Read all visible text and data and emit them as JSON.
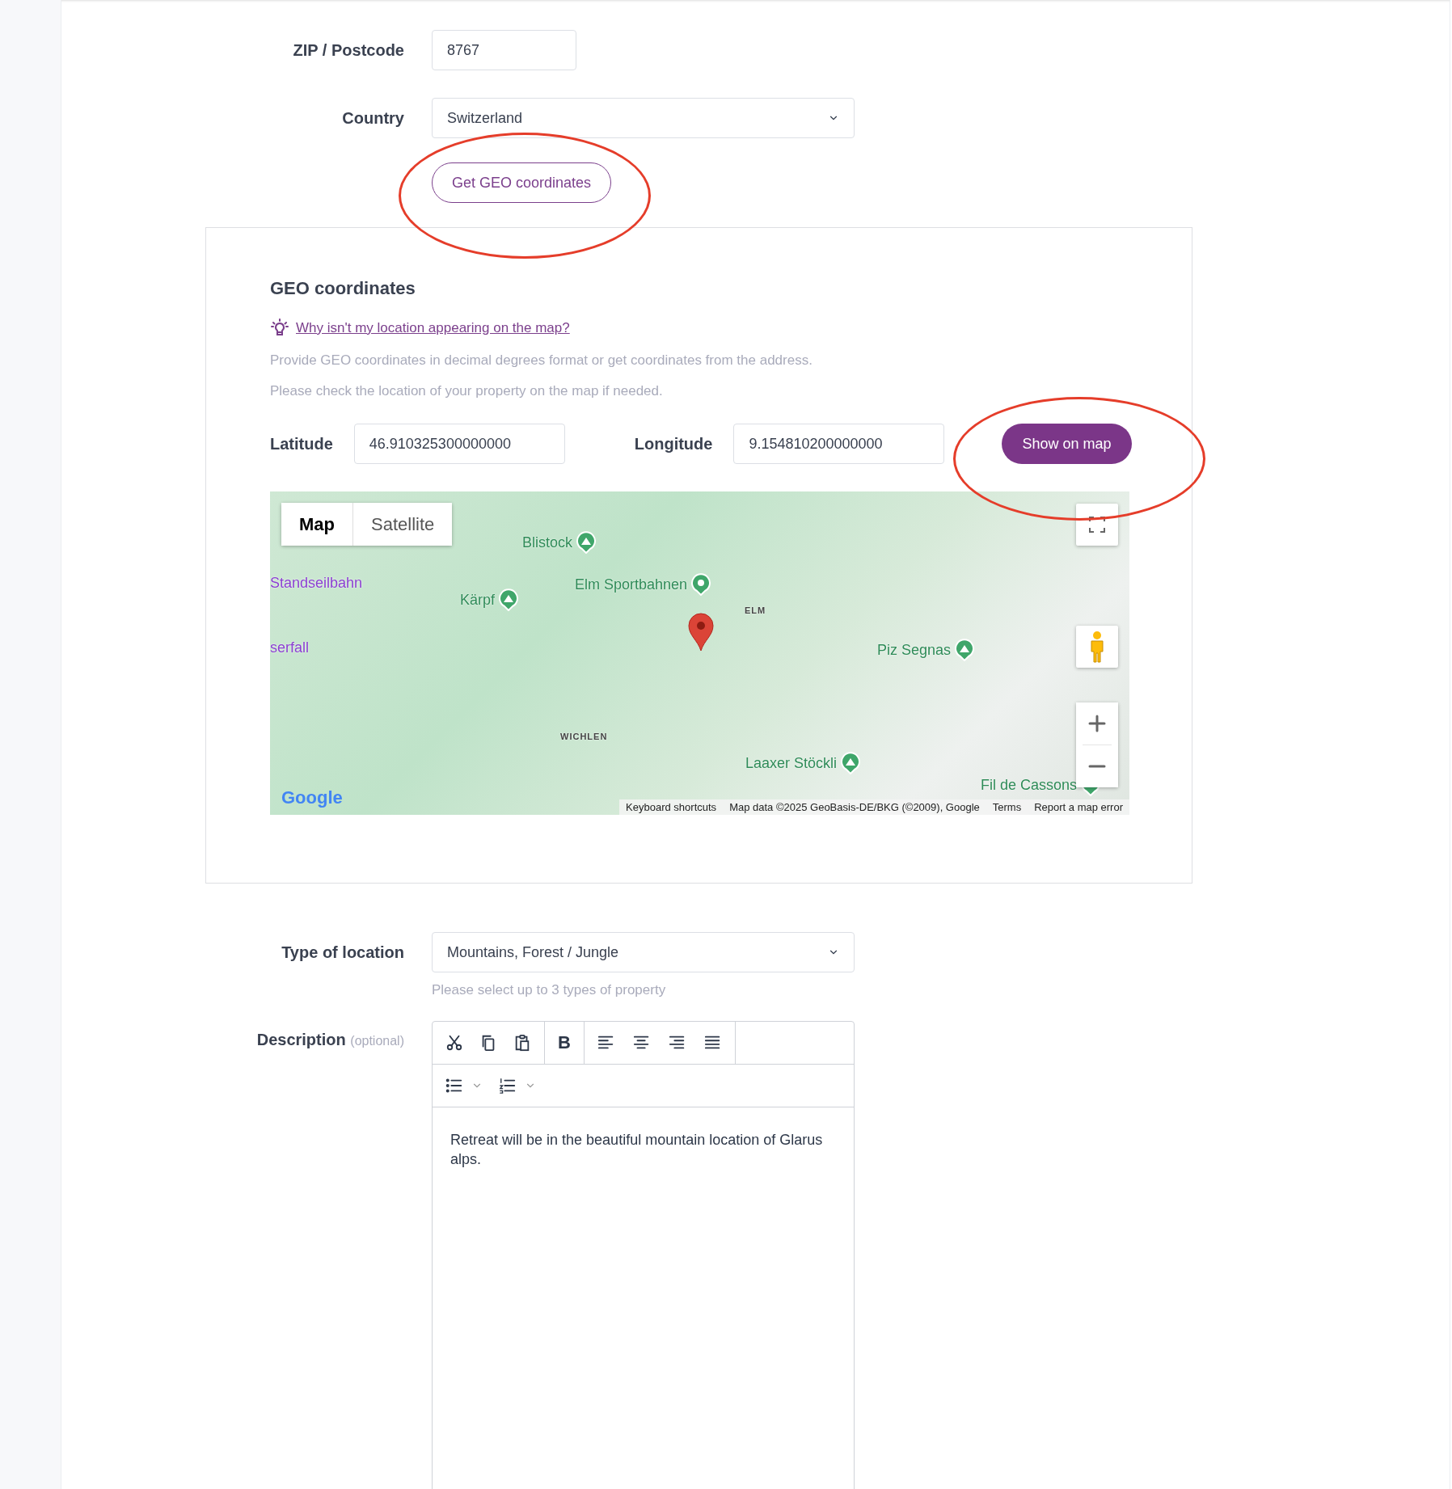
{
  "address": {
    "fields": [
      {
        "label": "ZIP / Postcode",
        "kind": "text",
        "value": "8767"
      },
      {
        "label": "Country",
        "kind": "select",
        "value": "Switzerland"
      }
    ],
    "geo_button": "Get GEO coordinates"
  },
  "geo_panel": {
    "title": "GEO coordinates",
    "help_link": "Why isn't my location appearing on the map?",
    "hints": [
      "Provide GEO coordinates in decimal degrees format or get coordinates from the address.",
      "Please check the location of your property on the map if needed."
    ],
    "latitude": {
      "label": "Latitude",
      "value": "46.910325300000000"
    },
    "longitude": {
      "label": "Longitude",
      "value": "9.154810200000000"
    },
    "show_button": "Show on map",
    "map": {
      "tabs": [
        {
          "label": "Map",
          "selected": true
        },
        {
          "label": "Satellite",
          "selected": false
        }
      ],
      "labels": [
        {
          "text": "Blistock",
          "kind": "peak"
        },
        {
          "text": "Elm Sportbahnen",
          "kind": "poi"
        },
        {
          "text": "Kärpf",
          "kind": "peak"
        },
        {
          "text": "ELM",
          "kind": "place"
        },
        {
          "text": "Standseilbahn",
          "kind": "transit"
        },
        {
          "text": "serfall",
          "kind": "transit"
        },
        {
          "text": "Piz Segnas",
          "kind": "peak"
        },
        {
          "text": "WICHLEN",
          "kind": "place"
        },
        {
          "text": "Laaxer Stöckli",
          "kind": "peak"
        },
        {
          "text": "Fil de Cassons",
          "kind": "peak"
        }
      ],
      "logo": "Google",
      "attribution": [
        "Keyboard shortcuts",
        "Map data ©2025 GeoBasis-DE/BKG (©2009), Google",
        "Terms",
        "Report a map error"
      ]
    }
  },
  "type_of_location": {
    "label": "Type of location",
    "value": "Mountains, Forest / Jungle",
    "hint": "Please select up to 3 types of property"
  },
  "description": {
    "label": "Description",
    "optional": "(optional)",
    "bold_glyph": "B",
    "text": "Retreat will be in the beautiful mountain location of Glarus alps."
  }
}
